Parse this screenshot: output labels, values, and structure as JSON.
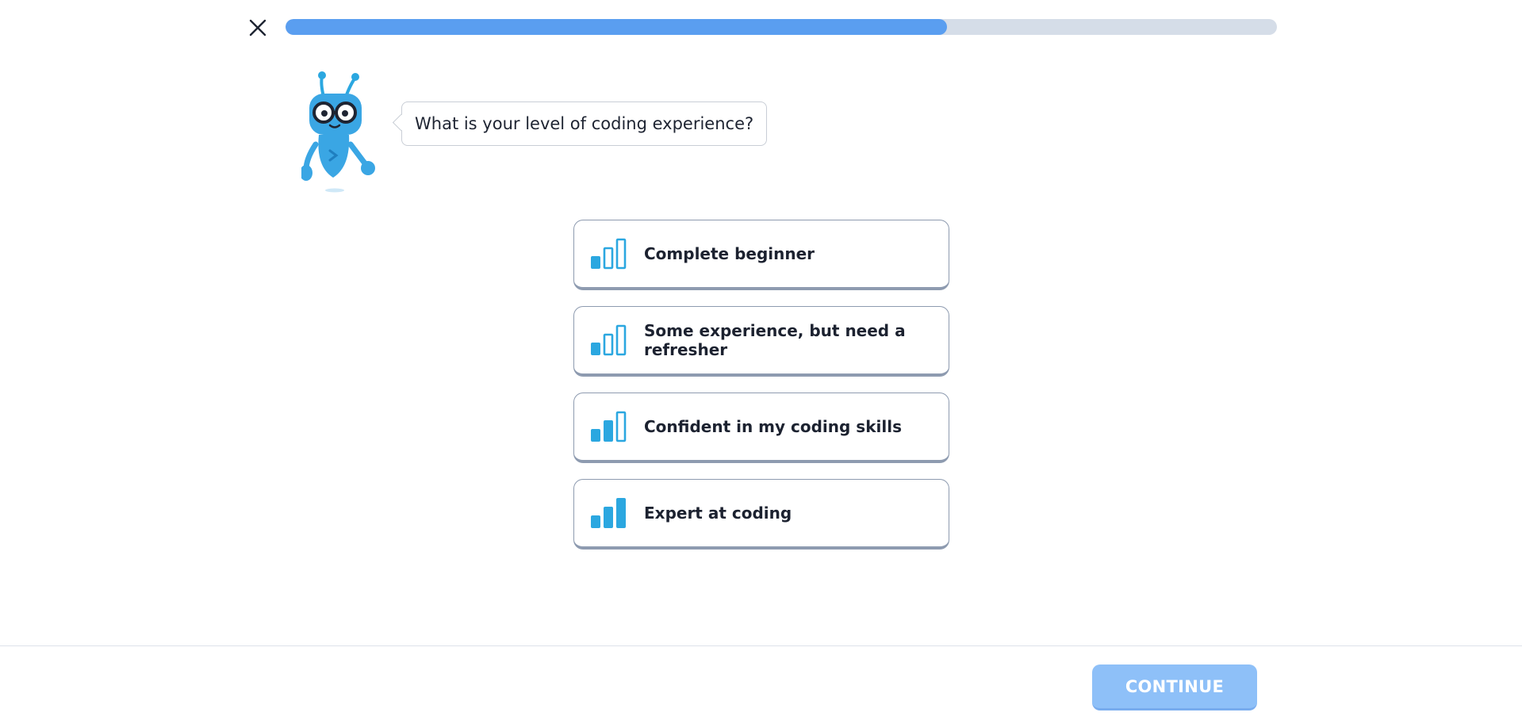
{
  "progress": {
    "fraction": 0.667
  },
  "prompt": {
    "question": "What is your level of coding experience?"
  },
  "options": [
    {
      "label": "Complete beginner",
      "icon": "signal-1-of-3-icon",
      "level": 1
    },
    {
      "label": "Some experience, but need a refresher",
      "icon": "signal-1-of-3-icon",
      "level": 1
    },
    {
      "label": "Confident in my coding skills",
      "icon": "signal-2-of-3-icon",
      "level": 2
    },
    {
      "label": "Expert at coding",
      "icon": "signal-3-of-3-icon",
      "level": 3
    }
  ],
  "footer": {
    "continue_label": "CONTINUE"
  },
  "colors": {
    "accent": "#5a9ef0",
    "icon": "#2ba7e0",
    "continue_disabled": "#8ec0f8",
    "track": "#d5dde8"
  }
}
